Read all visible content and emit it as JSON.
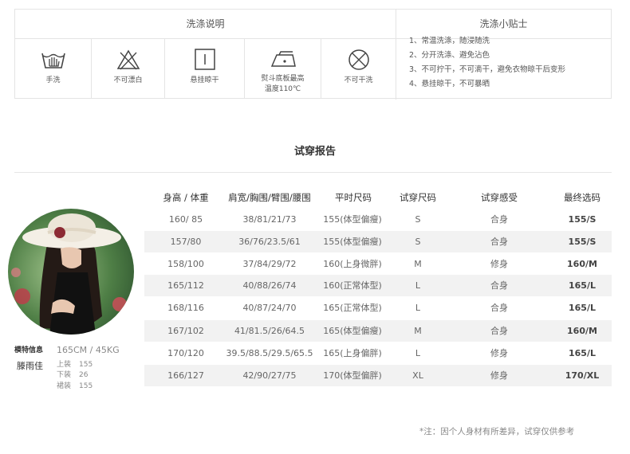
{
  "care": {
    "wash_title": "洗涤说明",
    "tips_title": "洗涤小贴士",
    "icons": [
      {
        "icon": "hand-wash-icon",
        "label": "手洗"
      },
      {
        "icon": "no-bleach-icon",
        "label": "不可漂白"
      },
      {
        "icon": "hang-dry-icon",
        "label": "悬挂晾干"
      },
      {
        "icon": "iron-icon",
        "label": "熨斗底板最高",
        "label2": "温度110℃"
      },
      {
        "icon": "no-dry-clean-icon",
        "label": "不可干洗"
      }
    ],
    "tips": [
      "1、常温洗涤，随浸随洗",
      "2、分开洗涤、避免沾色",
      "3、不可拧干，不可滴干，避免衣物晾干后变形",
      "4、悬挂晾干，不可暴晒"
    ]
  },
  "report": {
    "title": "试穿报告",
    "headers": [
      "身高 / 体重",
      "肩宽/胸围/臂围/腰围",
      "平时尺码",
      "试穿尺码",
      "试穿感受",
      "最终选码"
    ],
    "rows": [
      [
        "160/ 85",
        "38/81/21/73",
        "155(体型偏瘦)",
        "S",
        "合身",
        "155/S"
      ],
      [
        "157/80",
        "36/76/23.5/61",
        "155(体型偏瘦)",
        "S",
        "合身",
        "155/S"
      ],
      [
        "158/100",
        "37/84/29/72",
        "160(上身微胖)",
        "M",
        "修身",
        "160/M"
      ],
      [
        "165/112",
        "40/88/26/74",
        "160(正常体型)",
        "L",
        "合身",
        "165/L"
      ],
      [
        "168/116",
        "40/87/24/70",
        "165(正常体型)",
        "L",
        "合身",
        "165/L"
      ],
      [
        "167/102",
        "41/81.5/26/64.5",
        "165(体型偏瘦)",
        "M",
        "合身",
        "160/M"
      ],
      [
        "170/120",
        "39.5/88.5/29.5/65.5",
        "165(上身偏胖)",
        "L",
        "修身",
        "165/L"
      ],
      [
        "166/127",
        "42/90/27/75",
        "170(体型偏胖)",
        "XL",
        "修身",
        "170/XL"
      ]
    ]
  },
  "model": {
    "label": "模特信息",
    "name": "滕雨佳",
    "height_weight": "165CM / 45KG",
    "sizes": [
      {
        "part": "上装",
        "value": "155"
      },
      {
        "part": "下装",
        "value": "26"
      },
      {
        "part": "裙装",
        "value": "155"
      }
    ]
  },
  "footnote": "*注：因个人身材有所差异，试穿仅供参考",
  "colors": {
    "border": "#e4e4e4",
    "row_alt": "#f2f2f2",
    "text": "#555555"
  }
}
